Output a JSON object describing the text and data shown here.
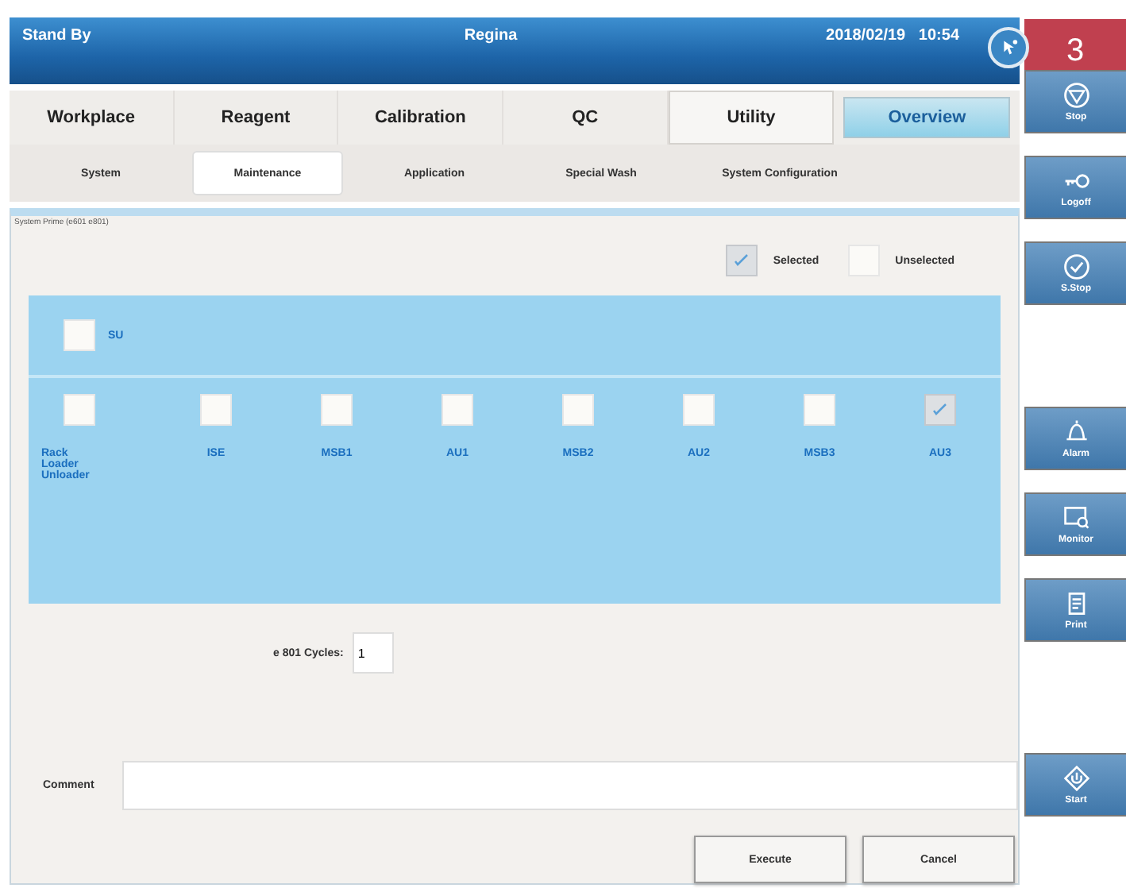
{
  "header": {
    "status": "Stand By",
    "mode": "Regina",
    "datetime": "2018/02/19   10:54",
    "badge": "3"
  },
  "tabs": [
    {
      "label": "Workplace",
      "selected": false
    },
    {
      "label": "Reagent",
      "selected": false
    },
    {
      "label": "Calibration",
      "selected": false
    },
    {
      "label": "QC",
      "selected": false
    },
    {
      "label": "Utility",
      "selected": true
    },
    {
      "label": "Overview",
      "selected": false,
      "kind": "overview"
    }
  ],
  "subtabs": [
    {
      "label": "System",
      "selected": false
    },
    {
      "label": "Maintenance",
      "selected": true
    },
    {
      "label": "Application",
      "selected": false
    },
    {
      "label": "Special Wash",
      "selected": false
    },
    {
      "label": "System Configuration",
      "selected": false
    }
  ],
  "panel": {
    "title": "System Prime (e601 e801)",
    "legend": [
      {
        "label": "Selected",
        "checked": true
      },
      {
        "label": "Unselected",
        "checked": false
      }
    ],
    "su": {
      "label": "SU",
      "checked": false
    },
    "units": [
      {
        "label": "Rack Loader Unloader",
        "checked": false
      },
      {
        "label": "ISE",
        "checked": false
      },
      {
        "label": "MSB1",
        "checked": false
      },
      {
        "label": "AU1",
        "checked": false
      },
      {
        "label": "MSB2",
        "checked": false
      },
      {
        "label": "AU2",
        "checked": false
      },
      {
        "label": "MSB3",
        "checked": false
      },
      {
        "label": "AU3",
        "checked": true
      }
    ],
    "cycles": {
      "label": "e 801 Cycles:",
      "value": "1"
    },
    "comment": {
      "label": "Comment"
    },
    "buttons": [
      "Execute",
      "Cancel"
    ]
  },
  "side_buttons": [
    {
      "label": "Stop",
      "kind": "stop"
    },
    {
      "label": "Logoff",
      "kind": "logoff"
    },
    {
      "label": "S.Stop",
      "kind": "sstop"
    },
    {
      "label": "Alarm",
      "kind": "alarm"
    },
    {
      "label": "Monitor",
      "kind": "monitor"
    },
    {
      "label": "Print",
      "kind": "print"
    },
    {
      "label": "Start",
      "kind": "start"
    }
  ]
}
